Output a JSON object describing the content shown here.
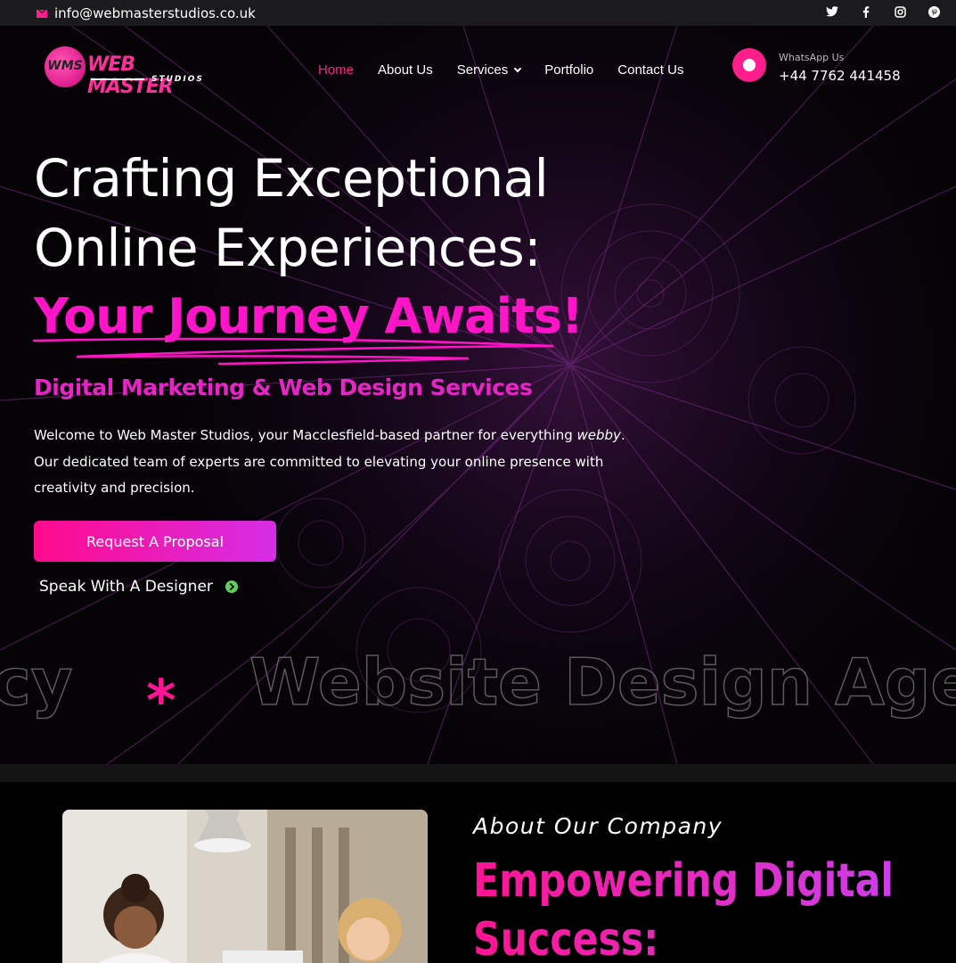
{
  "topbar": {
    "email": "info@webmasterstudios.co.uk",
    "socials": [
      "twitter-icon",
      "facebook-icon",
      "instagram-icon",
      "pinterest-icon"
    ]
  },
  "logo": {
    "badge": "WMS",
    "name": "WEB MASTER",
    "sub": "STUDIOS"
  },
  "nav": {
    "items": [
      "Home",
      "About Us",
      "Services",
      "Portfolio",
      "Contact Us"
    ],
    "active": "Home"
  },
  "whatsapp": {
    "label": "WhatsApp Us",
    "phone": "+44 7762 441458"
  },
  "hero": {
    "line1": "Crafting Exceptional",
    "line2": "Online Experiences:",
    "line3": "Your Journey Awaits!",
    "subtitle": "Digital Marketing & Web Design Services",
    "paragraph_start": "Welcome to Web Master Studios, your Macclesfield-based partner for everything ",
    "paragraph_em": "webby",
    "paragraph_end": ". Our dedicated team of experts are committed to elevating your online presence with creativity and precision.",
    "cta": "Request A Proposal",
    "secondary": "Speak With A Designer"
  },
  "marquee": {
    "text_left": "cy",
    "separator": "*",
    "text_right": "Website Design Agen"
  },
  "about": {
    "kicker": "About Our Company",
    "title_line1": "Empowering Digital",
    "title_line2": "Success:"
  },
  "colors": {
    "accent": "#ff1e8c",
    "purple": "#d52ee6",
    "background": "#000000"
  }
}
